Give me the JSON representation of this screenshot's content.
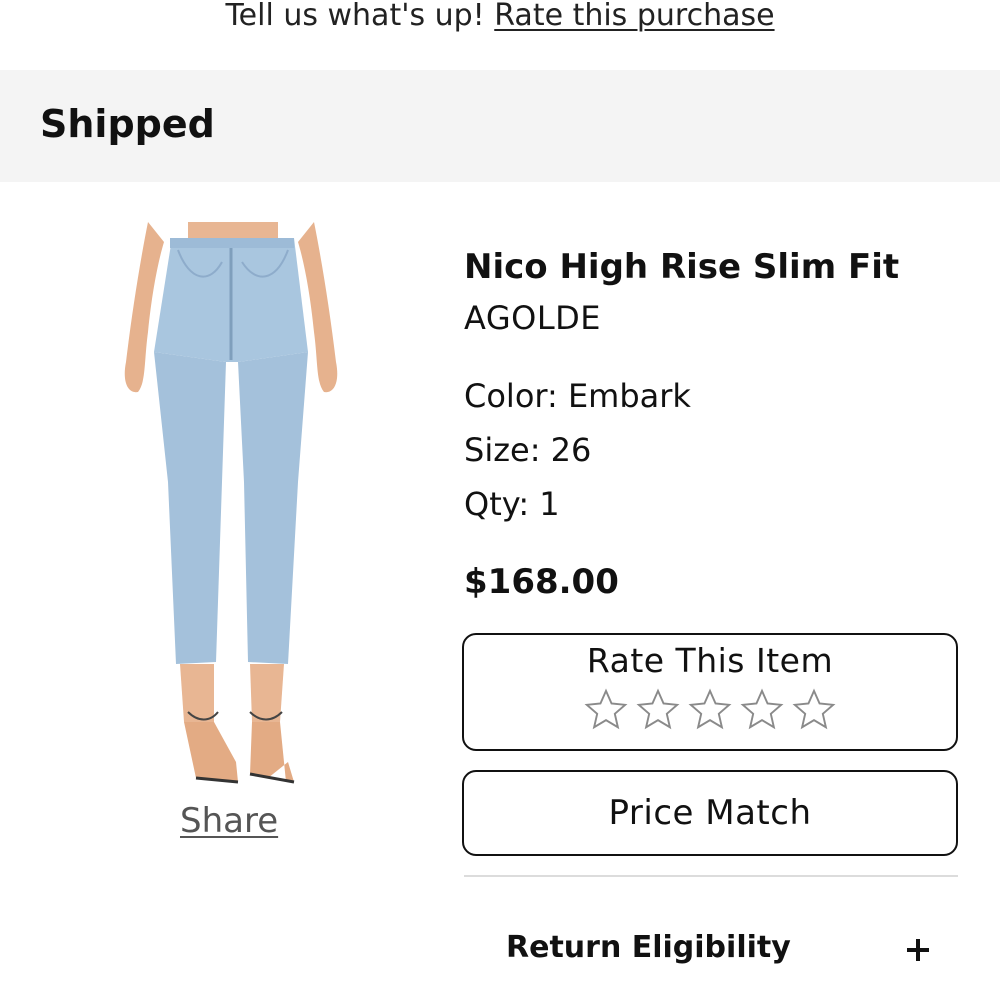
{
  "banner": {
    "prefix": "Tell us what's up!",
    "link": "Rate this purchase"
  },
  "status": {
    "title": "Shipped"
  },
  "product": {
    "name": "Nico High Rise Slim Fit",
    "brand": "AGOLDE",
    "color": "Color: Embark",
    "size": "Size: 26",
    "qty": "Qty: 1",
    "price": "$168.00",
    "image_icon": "jeans-product-photo",
    "share_label": "Share"
  },
  "rating": {
    "title": "Rate This Item",
    "stars": 5,
    "selected": 0
  },
  "actions": {
    "price_match": "Price Match"
  },
  "return_section": {
    "label": "Return Eligibility",
    "expand_icon": "plus-icon"
  },
  "colors": {
    "denim": "#a9c6df",
    "skin": "#e8b693",
    "status_bg": "#f4f4f4"
  }
}
